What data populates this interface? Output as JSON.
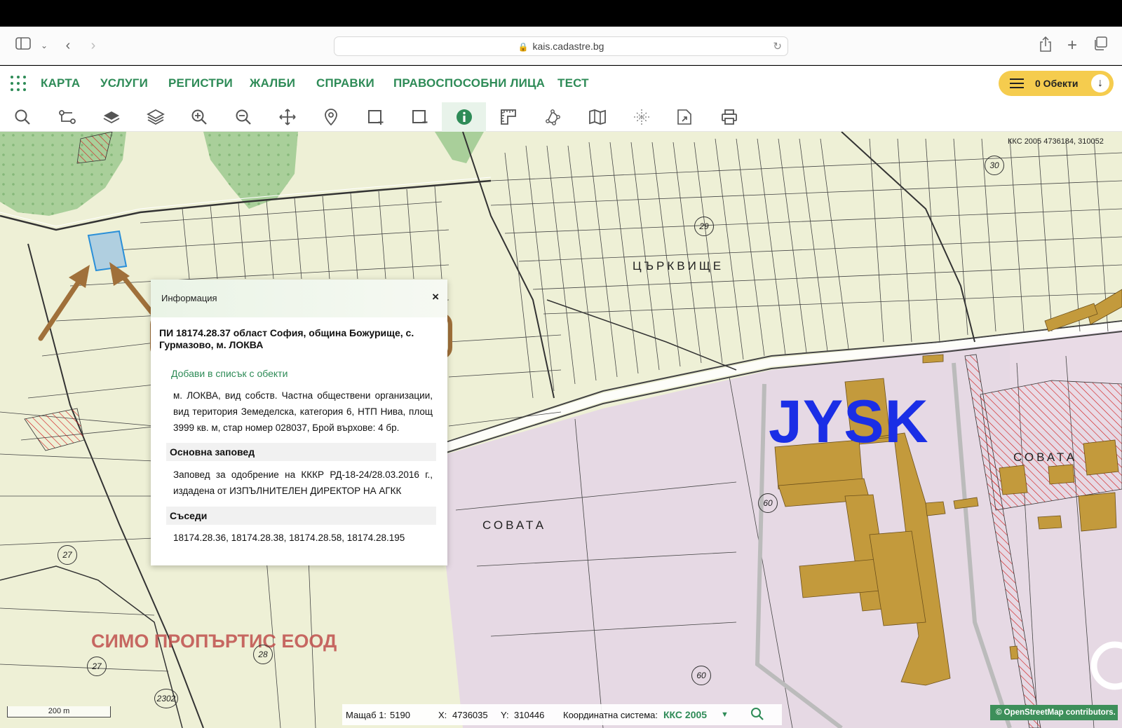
{
  "browser": {
    "url": "kais.cadastre.bg"
  },
  "nav": {
    "items": [
      "КАРТА",
      "УСЛУГИ",
      "РЕГИСТРИ",
      "ЖАЛБИ",
      "СПРАВКИ",
      "ПРАВОСПОСОБНИ ЛИЦА",
      "ТЕСТ"
    ],
    "objects_label": "0 Обекти"
  },
  "toolbar": {
    "tools": [
      "search-icon",
      "route-icon",
      "layers-icon",
      "layers-stack-icon",
      "zoom-in-icon",
      "zoom-out-icon",
      "pan-icon",
      "location-pin-icon",
      "select-add-icon",
      "select-remove-icon",
      "info-icon",
      "measure-icon",
      "polygon-icon",
      "map-icon",
      "grid-icon",
      "export-icon",
      "print-icon"
    ],
    "active": "info-icon"
  },
  "map": {
    "coords_top": "ККС 2005 4736184, 310052",
    "labels": {
      "tsarkvishte": "ЦЪРКВИЩЕ",
      "sovata1": "СОВАТА",
      "sovata2": "СОВАТА",
      "jysk": "JYSK",
      "company": "СИМО ПРОПЪРТИС ЕООД"
    },
    "numbers": {
      "n30": "30",
      "n29": "29",
      "n27a": "27",
      "n27b": "27",
      "n28": "28",
      "n60a": "60",
      "n60b": "60",
      "n2302": "2302"
    },
    "colors": {
      "land": "#eef0d6",
      "forest": "#a9cf9a",
      "industrial": "#e6d9e4",
      "building": "#c39a3c",
      "highlight": "#b0cfe0",
      "annotation": "#a0703a",
      "jysk": "#1a2ee6"
    }
  },
  "popup": {
    "title": "Информация",
    "close": "×",
    "parcel": "ПИ 18174.28.37 област София, община Божурище, с. Гурмазово, м. ЛОКВА",
    "add_link": "Добави в списък с обекти",
    "description": "м. ЛОКВА, вид собств. Частна обществени организации, вид територия Земеделска, категория 6, НТП Нива, площ 3999 кв. м, стар номер 028037, Брой върхове: 4 бр.",
    "order_title": "Основна заповед",
    "order_text": "Заповед за одобрение на КККР РД-18-24/28.03.2016 г., издадена от ИЗПЪЛНИТЕЛЕН ДИРЕКТОР НА АГКК",
    "neighbors_title": "Съседи",
    "neighbors": "18174.28.36, 18174.28.38, 18174.28.58, 18174.28.195"
  },
  "status": {
    "scale_label": "Мащаб 1:",
    "scale_value": "5190",
    "x_label": "X:",
    "x_value": "4736035",
    "y_label": "Y:",
    "y_value": "310446",
    "crs_label": "Координатна система:",
    "crs_value": "ККС 2005",
    "scalebar": "200 m",
    "osm": "© OpenStreetMap contributors."
  }
}
